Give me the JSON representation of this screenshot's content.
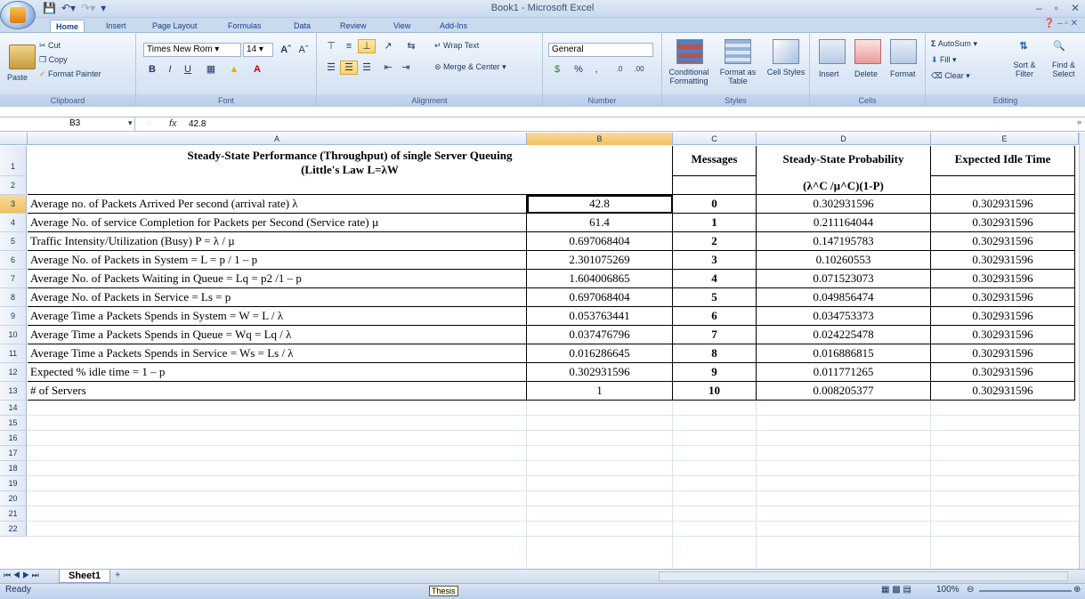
{
  "window": {
    "title": "Book1 - Microsoft Excel"
  },
  "tabs": [
    "Home",
    "Insert",
    "Page Layout",
    "Formulas",
    "Data",
    "Review",
    "View",
    "Add-Ins"
  ],
  "ribbon": {
    "clipboard": {
      "label": "Clipboard",
      "paste": "Paste",
      "cut": "Cut",
      "copy": "Copy",
      "format_painter": "Format Painter"
    },
    "font": {
      "label": "Font",
      "name": "Times New Rom",
      "size": "14"
    },
    "alignment": {
      "label": "Alignment",
      "wrap": "Wrap Text",
      "merge": "Merge & Center"
    },
    "number": {
      "label": "Number",
      "format": "General"
    },
    "styles": {
      "label": "Styles",
      "conditional": "Conditional Formatting",
      "format_table": "Format as Table",
      "cell_styles": "Cell Styles"
    },
    "cells": {
      "label": "Cells",
      "insert": "Insert",
      "delete": "Delete",
      "format": "Format"
    },
    "editing": {
      "label": "Editing",
      "autosum": "AutoSum",
      "fill": "Fill",
      "clear": "Clear",
      "sort": "Sort & Filter",
      "find": "Find & Select"
    }
  },
  "formula_bar": {
    "name_box": "B3",
    "fx": "fx",
    "content": "42.8"
  },
  "columns": [
    "A",
    "B",
    "C",
    "D",
    "E"
  ],
  "row_numbers": [
    "1",
    "2",
    "3",
    "4",
    "5",
    "6",
    "7",
    "8",
    "9",
    "10",
    "11",
    "12",
    "13",
    "14",
    "15",
    "16",
    "17",
    "18",
    "19",
    "20",
    "21",
    "22"
  ],
  "sheet": {
    "title_line1": "Steady-State Performance (Throughput) of single Server Queuing",
    "title_line2": "(Little's Law L=λW",
    "header_c": "Messages",
    "header_d": "Steady-State Probability",
    "header_d2": "(λ^C /µ^C)(1-P)",
    "header_e": "Expected Idle Time",
    "rows": [
      {
        "a": "Average no. of Packets Arrived Per second (arrival rate) λ",
        "b": "42.8",
        "c": "0",
        "d": "0.302931596",
        "e": "0.302931596"
      },
      {
        "a": "Average No. of service Completion for Packets per Second (Service rate)  µ",
        "b": "61.4",
        "c": "1",
        "d": "0.211164044",
        "e": "0.302931596"
      },
      {
        "a": "Traffic Intensity/Utilization (Busy) P = λ / µ",
        "b": "0.697068404",
        "c": "2",
        "d": "0.147195783",
        "e": "0.302931596"
      },
      {
        "a": "Average No. of Packets in System = L = p / 1 – p",
        "b": "2.301075269",
        "c": "3",
        "d": "0.10260553",
        "e": "0.302931596"
      },
      {
        "a": "Average No. of Packets Waiting in Queue = Lq = p2 /1 – p",
        "b": "1.604006865",
        "c": "4",
        "d": "0.071523073",
        "e": "0.302931596"
      },
      {
        "a": "Average No. of Packets in Service = Ls = p",
        "b": "0.697068404",
        "c": "5",
        "d": "0.049856474",
        "e": "0.302931596"
      },
      {
        "a": "Average Time a Packets Spends in System = W = L / λ",
        "b": "0.053763441",
        "c": "6",
        "d": "0.034753373",
        "e": "0.302931596"
      },
      {
        "a": "Average Time a Packets Spends in Queue = Wq = Lq / λ",
        "b": "0.037476796",
        "c": "7",
        "d": "0.024225478",
        "e": "0.302931596"
      },
      {
        "a": "Average Time a Packets Spends in Service = Ws = Ls / λ",
        "b": "0.016286645",
        "c": "8",
        "d": "0.016886815",
        "e": "0.302931596"
      },
      {
        "a": "Expected % idle time = 1 – p",
        "b": "0.302931596",
        "c": "9",
        "d": "0.011771265",
        "e": "0.302931596"
      },
      {
        "a": "# of Servers",
        "b": "1",
        "c": "10",
        "d": "0.008205377",
        "e": "0.302931596"
      }
    ]
  },
  "sheet_tab": "Sheet1",
  "status": {
    "ready": "Ready",
    "tooltip": "Thesis",
    "zoom": "100%"
  },
  "colors": {
    "accent": "#15428b",
    "selected_header": "#f1c15f",
    "ribbon": "#dde8f6"
  }
}
